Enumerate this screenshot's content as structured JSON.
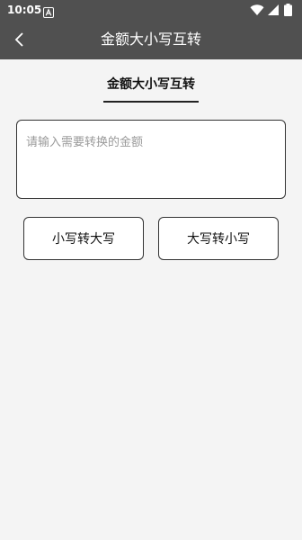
{
  "status_bar": {
    "time": "10:05",
    "notification_icon": "font-a-icon",
    "wifi_icon": "wifi-icon",
    "signal_icon": "signal-icon",
    "battery_icon": "battery-icon"
  },
  "app_bar": {
    "back_icon": "chevron-left-icon",
    "title": "金额大小写互转",
    "background": "#505050"
  },
  "tab": {
    "label": "金额大小写互转"
  },
  "input": {
    "placeholder": "请输入需要转换的金额",
    "value": ""
  },
  "buttons": {
    "to_upper": "小写转大写",
    "to_lower": "大写转小写"
  },
  "colors": {
    "page_background": "#f4f4f4",
    "border": "#333333",
    "placeholder": "#9a9a9a"
  }
}
